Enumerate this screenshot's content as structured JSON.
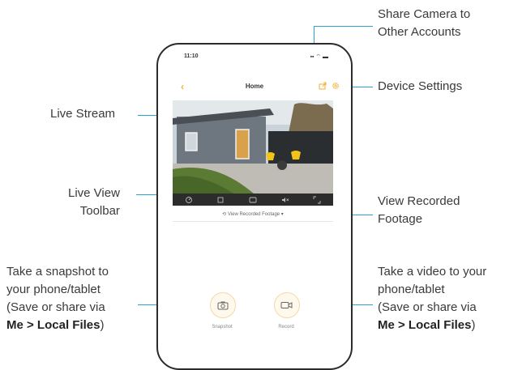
{
  "phone": {
    "status_time": "11:10",
    "status_icons": "▪▪ ⌔ ▬",
    "back_glyph": "‹",
    "nav_title": "Home",
    "recorded_label": "View Recorded Footage",
    "snapshot_label": "Snapshot",
    "record_label": "Record"
  },
  "callouts": {
    "share_line1": "Share Camera to",
    "share_line2": "Other Accounts",
    "device_settings": "Device Settings",
    "live_stream": "Live Stream",
    "toolbar_line1": "Live View",
    "toolbar_line2": "Toolbar",
    "recorded_line1": "View Recorded",
    "recorded_line2": "Footage",
    "snap_line1": "Take a snapshot to",
    "snap_line2": "your phone/tablet",
    "snap_line3": "(Save or share via",
    "snap_bold": "Me > Local Files",
    "snap_close": ")",
    "video_line1": "Take a video to your",
    "video_line2": "phone/tablet",
    "video_line3": "(Save or share via",
    "video_bold": "Me > Local Files",
    "video_close": ")"
  },
  "colors": {
    "accent": "#29a4cf",
    "brand": "#f2b233",
    "toolbar": "#2c2c2c"
  }
}
